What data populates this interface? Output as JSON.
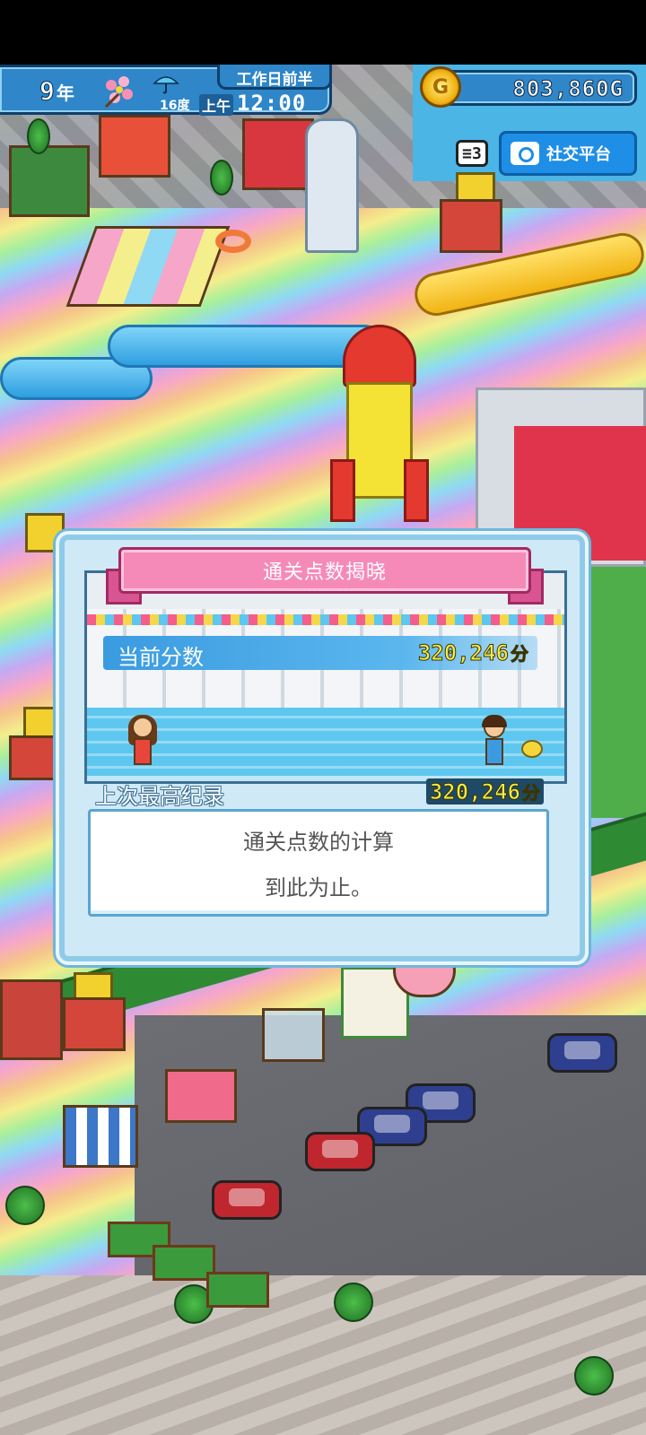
{
  "hud": {
    "year_number": "9",
    "year_unit": "年",
    "period": "工作日前半",
    "temperature_label": "16度",
    "am_pm": "上午",
    "time": "12:00",
    "money": "803,860G",
    "coin_symbol": "G",
    "speed_label": "≡3",
    "social_button_label": "社交平台"
  },
  "dialog": {
    "title": "通关点数揭晓",
    "current_score_label": "当前分数",
    "current_score_value": "320,246",
    "score_unit": "分",
    "best_record_label": "上次最高纪录",
    "best_record_value": "320,246",
    "message_lines": [
      "通关点数的计算",
      "到此为止。"
    ]
  },
  "icons": {
    "flower": "flower-icon",
    "umbrella": "umbrella-icon",
    "coin": "coin-icon",
    "camera": "camera-icon"
  },
  "colors": {
    "hud_blue": "#2f86c8",
    "banner_pink": "#f58ab9",
    "score_yellow": "#f5ec4a",
    "social_blue": "#1e8ee6"
  }
}
